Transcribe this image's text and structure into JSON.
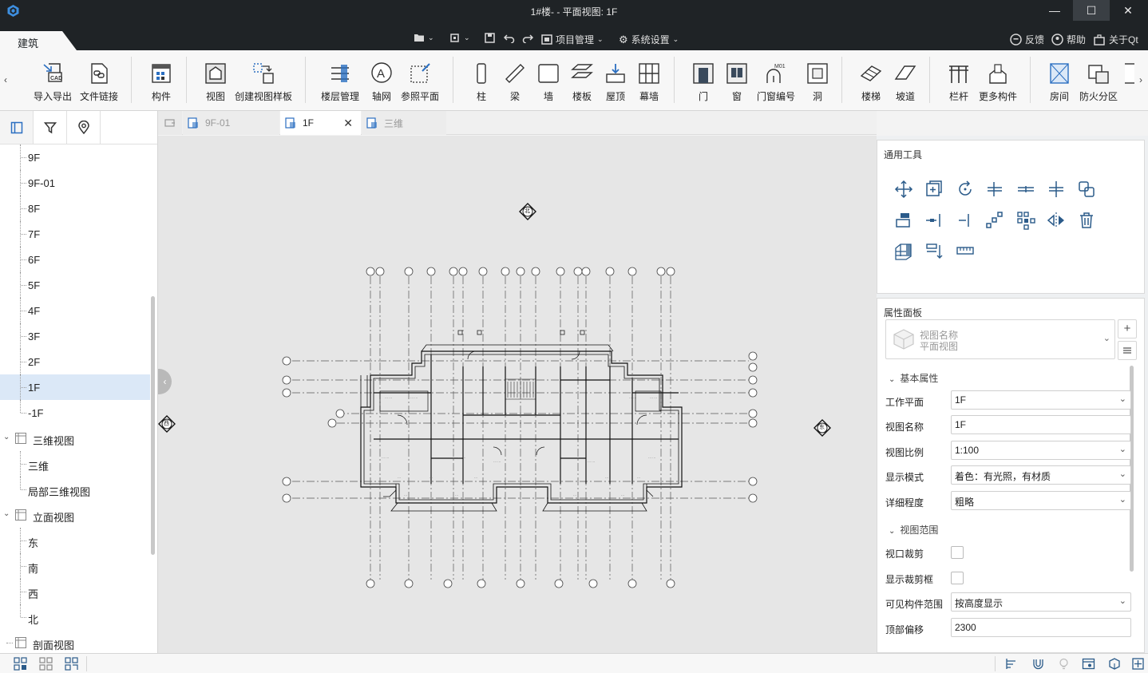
{
  "window": {
    "title": "1#楼- - 平面视图: 1F",
    "controls": {
      "minimize": "—",
      "maximize": "☐",
      "close": "✕"
    }
  },
  "menu": {
    "active_tab": "建筑",
    "project_mgmt": "项目管理",
    "system_settings": "系统设置",
    "feedback": "反馈",
    "help": "帮助",
    "about": "关于Qt"
  },
  "ribbon": {
    "import_export": "导入导出",
    "file_link": "文件链接",
    "component": "构件",
    "view": "视图",
    "create_view_template": "创建视图样板",
    "floor_mgmt": "楼层管理",
    "grid": "轴网",
    "ref_plane": "参照平面",
    "column": "柱",
    "beam": "梁",
    "wall": "墙",
    "floor": "楼板",
    "roof": "屋顶",
    "curtain_wall": "幕墙",
    "door": "门",
    "window": "窗",
    "door_window_tag": "门窗编号",
    "opening": "洞",
    "stairs": "楼梯",
    "ramp": "坡道",
    "railing": "栏杆",
    "more_components": "更多构件",
    "room": "房间",
    "fire_zone": "防火分区",
    "scroll_left": "‹",
    "scroll_right": "›",
    "m01_tag": "M01"
  },
  "tree": {
    "levels": [
      "9F",
      "9F-01",
      "8F",
      "7F",
      "6F",
      "5F",
      "4F",
      "3F",
      "2F",
      "1F",
      "-1F"
    ],
    "group_3d": "三维视图",
    "item_3d": "三维",
    "item_partial_3d": "局部三维视图",
    "group_elevation": "立面视图",
    "elevations": [
      "东",
      "南",
      "西",
      "北"
    ],
    "group_section": "剖面视图"
  },
  "tabs": [
    {
      "label": "9F-01"
    },
    {
      "label": "1F"
    },
    {
      "label": "三维"
    }
  ],
  "canvas": {
    "north_marker": "北",
    "west_marker": "西",
    "east_marker": "东",
    "collapse": "‹"
  },
  "tools_panel": {
    "title": "通用工具"
  },
  "props_panel": {
    "title": "属性面板",
    "view_name_label": "视图名称",
    "view_type": "平面视图",
    "section_basic": "基本属性",
    "work_plane_label": "工作平面",
    "work_plane": "1F",
    "view_name2_label": "视图名称",
    "view_name2": "1F",
    "scale_label": "视图比例",
    "scale": "1:100",
    "display_mode_label": "显示模式",
    "display_mode": "着色：有光照，有材质",
    "detail_label": "详细程度",
    "detail": "粗略",
    "section_range": "视图范围",
    "viewport_crop_label": "视口裁剪",
    "show_crop_label": "显示裁剪框",
    "visible_range_label": "可见构件范围",
    "visible_range": "按高度显示",
    "top_offset_label": "顶部偏移",
    "top_offset": "2300"
  },
  "colors": {
    "titlebar": "#1f2326",
    "selection": "#dbe8f7",
    "canvas": "#e6e6e6",
    "accent_blue": "#2b6fc1"
  }
}
